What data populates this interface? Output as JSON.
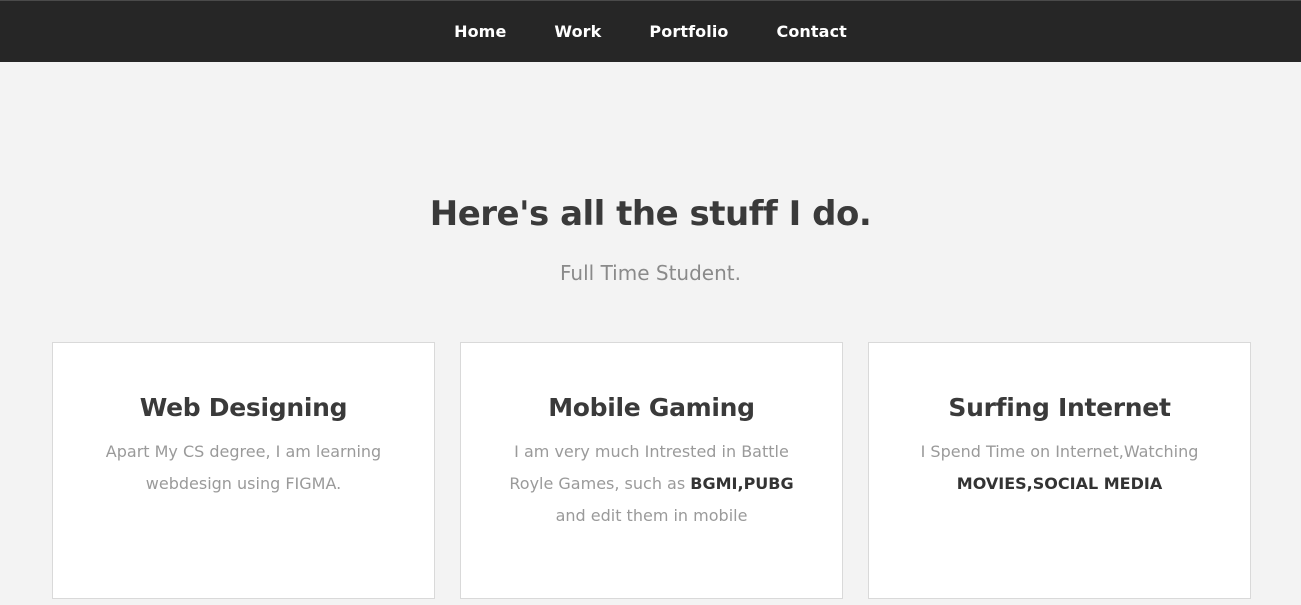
{
  "nav": {
    "items": [
      {
        "label": "Home"
      },
      {
        "label": "Work"
      },
      {
        "label": "Portfolio"
      },
      {
        "label": "Contact"
      }
    ]
  },
  "section": {
    "heading": "Here's all the stuff I do.",
    "subheading": "Full Time Student."
  },
  "cards": [
    {
      "title": "Web Designing",
      "text_1": "Apart My CS degree, I am learning webdesign using FIGMA."
    },
    {
      "title": "Mobile Gaming",
      "text_1": "I am very much Intrested in Battle Royle Games, such as ",
      "text_bold": "BGMI,PUBG",
      "text_2": " and edit them in mobile"
    },
    {
      "title": "Surfing Internet",
      "text_1": "I Spend Time on Internet,Watching ",
      "text_bold": "MOVIES,SOCIAL MEDIA"
    }
  ]
}
